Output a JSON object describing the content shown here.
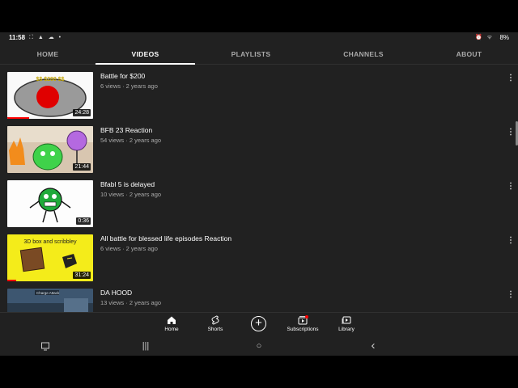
{
  "status_bar": {
    "time": "11:58",
    "left_icons": "⛶ ▲ ☁ •",
    "right_icons": "⏰ ᯤ",
    "battery": "8%"
  },
  "tabs": [
    {
      "label": "HOME",
      "active": false
    },
    {
      "label": "VIDEOS",
      "active": true
    },
    {
      "label": "PLAYLISTS",
      "active": false
    },
    {
      "label": "CHANNELS",
      "active": false
    },
    {
      "label": "ABOUT",
      "active": false
    }
  ],
  "videos": [
    {
      "title": "Battle for $200",
      "meta": "6 views · 2 years ago",
      "duration": "24:28",
      "thumb_text": "$$ $200 $$",
      "watched": 0.25
    },
    {
      "title": "BFB 23 Reaction",
      "meta": "54 views · 2 years ago",
      "duration": "21:44",
      "thumb_text": "",
      "watched": 0
    },
    {
      "title": "Bfabl 5 is delayed",
      "meta": "10 views · 2 years ago",
      "duration": "0:36",
      "thumb_text": "",
      "watched": 0
    },
    {
      "title": "All battle for blessed life episodes Reaction",
      "meta": "6 views · 2 years ago",
      "duration": "31:24",
      "thumb_text": "3D box and scribbley",
      "watched": 0.1
    },
    {
      "title": "DA HOOD",
      "meta": "13 views · 2 years ago",
      "duration": "",
      "thumb_text": "Charge Attack",
      "watched": 0
    }
  ],
  "more_icon": "⋮",
  "bottom_nav": [
    {
      "label": "Home",
      "icon": "home-icon",
      "active": true
    },
    {
      "label": "Shorts",
      "icon": "shorts-icon",
      "active": false
    },
    {
      "label": "",
      "icon": "add-icon",
      "active": false
    },
    {
      "label": "Subscriptions",
      "icon": "subscriptions-icon",
      "active": false
    },
    {
      "label": "Library",
      "icon": "library-icon",
      "active": false
    }
  ],
  "system_nav": {
    "recents": "|||",
    "home": "○",
    "back": "‹"
  },
  "colors": {
    "background": "#212121",
    "accent": "#ff0000",
    "text": "#ffffff",
    "secondary_text": "#aaaaaa"
  }
}
